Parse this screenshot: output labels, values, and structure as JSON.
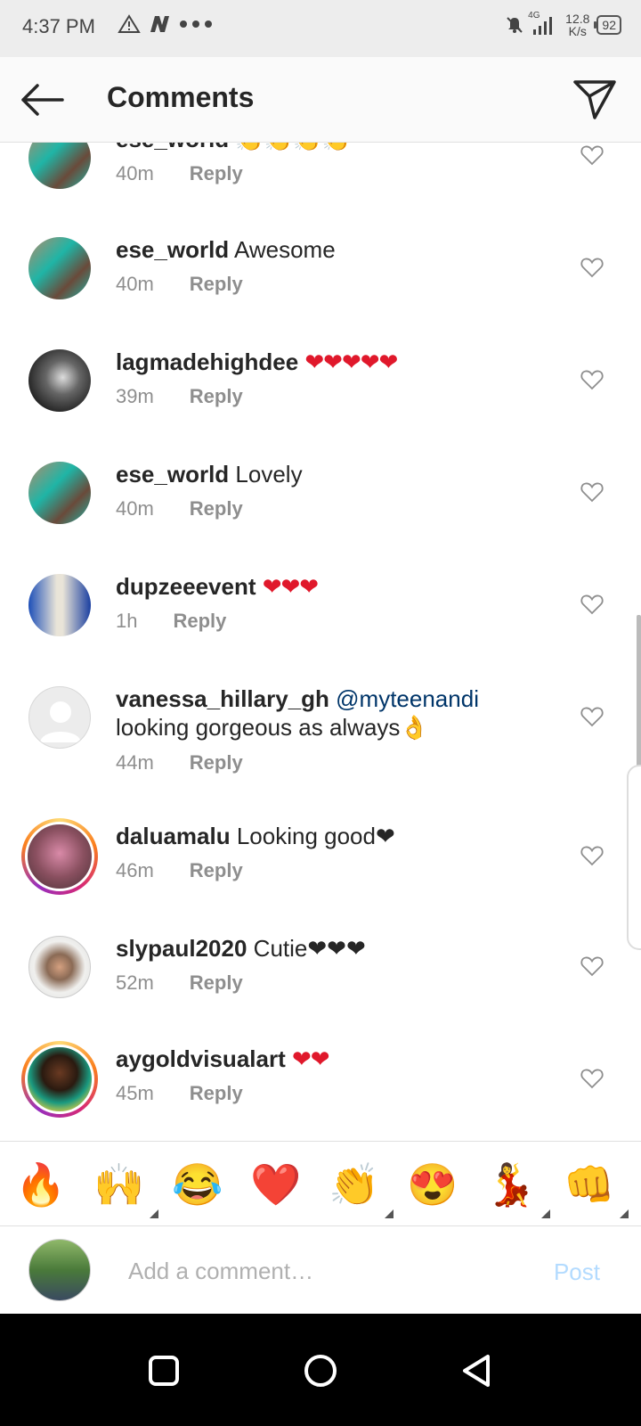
{
  "status_bar": {
    "time": "4:37 PM",
    "network": "4G",
    "speed_value": "12.8",
    "speed_unit": "K/s",
    "battery": "92"
  },
  "header": {
    "title": "Comments"
  },
  "comments": [
    {
      "username": "ese_world",
      "text": "👏👏👏👏",
      "time": "40m",
      "reply_label": "Reply",
      "avatar_icon": "girls-group-photo"
    },
    {
      "username": "ese_world",
      "text": "Awesome",
      "time": "40m",
      "reply_label": "Reply",
      "avatar_icon": "girls-group-photo"
    },
    {
      "username": "lagmadehighdee",
      "text": "❤❤❤❤❤",
      "time": "39m",
      "reply_label": "Reply",
      "avatar_icon": "bw-portrait"
    },
    {
      "username": "ese_world",
      "text": "Lovely",
      "time": "40m",
      "reply_label": "Reply",
      "avatar_icon": "girls-group-photo"
    },
    {
      "username": "dupzeeevent",
      "text": "❤❤❤",
      "time": "1h",
      "reply_label": "Reply",
      "avatar_icon": "blue-outfit-photo"
    },
    {
      "username": "vanessa_hillary_gh",
      "mention": "@myteenandi",
      "text": "looking gorgeous as always👌",
      "time": "44m",
      "reply_label": "Reply",
      "avatar_icon": "default-avatar"
    },
    {
      "username": "daluamalu",
      "text": "Looking good❤",
      "time": "46m",
      "reply_label": "Reply",
      "avatar_icon": "pink-portrait"
    },
    {
      "username": "slypaul2020",
      "text": "Cutie❤❤❤",
      "time": "52m",
      "reply_label": "Reply",
      "avatar_icon": "watch-photo"
    },
    {
      "username": "aygoldvisualart",
      "text": "❤❤",
      "time": "45m",
      "reply_label": "Reply",
      "avatar_icon": "woman-portrait"
    }
  ],
  "emoji_bar": [
    "🔥",
    "🙌",
    "😂",
    "❤️",
    "👏",
    "😍",
    "💃",
    "👊"
  ],
  "composer": {
    "placeholder": "Add a comment…",
    "post_label": "Post"
  },
  "colors": {
    "username": "#262626",
    "meta": "#8e8e8e",
    "mention": "#003569",
    "heart": "#e0182b",
    "post_disabled": "#b3dbff"
  }
}
